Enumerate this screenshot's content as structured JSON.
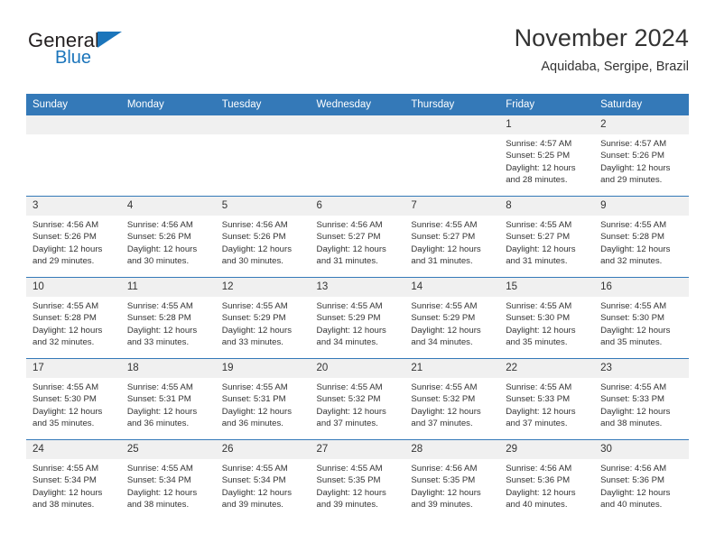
{
  "brand": {
    "name_part1": "General",
    "name_part2": "Blue",
    "accent_color": "#1b75bb"
  },
  "header": {
    "title": "November 2024",
    "location": "Aquidaba, Sergipe, Brazil"
  },
  "calendar": {
    "header_color": "#3479b8",
    "daynum_band_color": "#f0f0f0",
    "weekday_headers": [
      "Sunday",
      "Monday",
      "Tuesday",
      "Wednesday",
      "Thursday",
      "Friday",
      "Saturday"
    ],
    "weeks": [
      [
        {
          "day": "",
          "sunrise": "",
          "sunset": "",
          "daylight": "",
          "empty": true
        },
        {
          "day": "",
          "sunrise": "",
          "sunset": "",
          "daylight": "",
          "empty": true
        },
        {
          "day": "",
          "sunrise": "",
          "sunset": "",
          "daylight": "",
          "empty": true
        },
        {
          "day": "",
          "sunrise": "",
          "sunset": "",
          "daylight": "",
          "empty": true
        },
        {
          "day": "",
          "sunrise": "",
          "sunset": "",
          "daylight": "",
          "empty": true
        },
        {
          "day": "1",
          "sunrise": "Sunrise: 4:57 AM",
          "sunset": "Sunset: 5:25 PM",
          "daylight": "Daylight: 12 hours and 28 minutes."
        },
        {
          "day": "2",
          "sunrise": "Sunrise: 4:57 AM",
          "sunset": "Sunset: 5:26 PM",
          "daylight": "Daylight: 12 hours and 29 minutes."
        }
      ],
      [
        {
          "day": "3",
          "sunrise": "Sunrise: 4:56 AM",
          "sunset": "Sunset: 5:26 PM",
          "daylight": "Daylight: 12 hours and 29 minutes."
        },
        {
          "day": "4",
          "sunrise": "Sunrise: 4:56 AM",
          "sunset": "Sunset: 5:26 PM",
          "daylight": "Daylight: 12 hours and 30 minutes."
        },
        {
          "day": "5",
          "sunrise": "Sunrise: 4:56 AM",
          "sunset": "Sunset: 5:26 PM",
          "daylight": "Daylight: 12 hours and 30 minutes."
        },
        {
          "day": "6",
          "sunrise": "Sunrise: 4:56 AM",
          "sunset": "Sunset: 5:27 PM",
          "daylight": "Daylight: 12 hours and 31 minutes."
        },
        {
          "day": "7",
          "sunrise": "Sunrise: 4:55 AM",
          "sunset": "Sunset: 5:27 PM",
          "daylight": "Daylight: 12 hours and 31 minutes."
        },
        {
          "day": "8",
          "sunrise": "Sunrise: 4:55 AM",
          "sunset": "Sunset: 5:27 PM",
          "daylight": "Daylight: 12 hours and 31 minutes."
        },
        {
          "day": "9",
          "sunrise": "Sunrise: 4:55 AM",
          "sunset": "Sunset: 5:28 PM",
          "daylight": "Daylight: 12 hours and 32 minutes."
        }
      ],
      [
        {
          "day": "10",
          "sunrise": "Sunrise: 4:55 AM",
          "sunset": "Sunset: 5:28 PM",
          "daylight": "Daylight: 12 hours and 32 minutes."
        },
        {
          "day": "11",
          "sunrise": "Sunrise: 4:55 AM",
          "sunset": "Sunset: 5:28 PM",
          "daylight": "Daylight: 12 hours and 33 minutes."
        },
        {
          "day": "12",
          "sunrise": "Sunrise: 4:55 AM",
          "sunset": "Sunset: 5:29 PM",
          "daylight": "Daylight: 12 hours and 33 minutes."
        },
        {
          "day": "13",
          "sunrise": "Sunrise: 4:55 AM",
          "sunset": "Sunset: 5:29 PM",
          "daylight": "Daylight: 12 hours and 34 minutes."
        },
        {
          "day": "14",
          "sunrise": "Sunrise: 4:55 AM",
          "sunset": "Sunset: 5:29 PM",
          "daylight": "Daylight: 12 hours and 34 minutes."
        },
        {
          "day": "15",
          "sunrise": "Sunrise: 4:55 AM",
          "sunset": "Sunset: 5:30 PM",
          "daylight": "Daylight: 12 hours and 35 minutes."
        },
        {
          "day": "16",
          "sunrise": "Sunrise: 4:55 AM",
          "sunset": "Sunset: 5:30 PM",
          "daylight": "Daylight: 12 hours and 35 minutes."
        }
      ],
      [
        {
          "day": "17",
          "sunrise": "Sunrise: 4:55 AM",
          "sunset": "Sunset: 5:30 PM",
          "daylight": "Daylight: 12 hours and 35 minutes."
        },
        {
          "day": "18",
          "sunrise": "Sunrise: 4:55 AM",
          "sunset": "Sunset: 5:31 PM",
          "daylight": "Daylight: 12 hours and 36 minutes."
        },
        {
          "day": "19",
          "sunrise": "Sunrise: 4:55 AM",
          "sunset": "Sunset: 5:31 PM",
          "daylight": "Daylight: 12 hours and 36 minutes."
        },
        {
          "day": "20",
          "sunrise": "Sunrise: 4:55 AM",
          "sunset": "Sunset: 5:32 PM",
          "daylight": "Daylight: 12 hours and 37 minutes."
        },
        {
          "day": "21",
          "sunrise": "Sunrise: 4:55 AM",
          "sunset": "Sunset: 5:32 PM",
          "daylight": "Daylight: 12 hours and 37 minutes."
        },
        {
          "day": "22",
          "sunrise": "Sunrise: 4:55 AM",
          "sunset": "Sunset: 5:33 PM",
          "daylight": "Daylight: 12 hours and 37 minutes."
        },
        {
          "day": "23",
          "sunrise": "Sunrise: 4:55 AM",
          "sunset": "Sunset: 5:33 PM",
          "daylight": "Daylight: 12 hours and 38 minutes."
        }
      ],
      [
        {
          "day": "24",
          "sunrise": "Sunrise: 4:55 AM",
          "sunset": "Sunset: 5:34 PM",
          "daylight": "Daylight: 12 hours and 38 minutes."
        },
        {
          "day": "25",
          "sunrise": "Sunrise: 4:55 AM",
          "sunset": "Sunset: 5:34 PM",
          "daylight": "Daylight: 12 hours and 38 minutes."
        },
        {
          "day": "26",
          "sunrise": "Sunrise: 4:55 AM",
          "sunset": "Sunset: 5:34 PM",
          "daylight": "Daylight: 12 hours and 39 minutes."
        },
        {
          "day": "27",
          "sunrise": "Sunrise: 4:55 AM",
          "sunset": "Sunset: 5:35 PM",
          "daylight": "Daylight: 12 hours and 39 minutes."
        },
        {
          "day": "28",
          "sunrise": "Sunrise: 4:56 AM",
          "sunset": "Sunset: 5:35 PM",
          "daylight": "Daylight: 12 hours and 39 minutes."
        },
        {
          "day": "29",
          "sunrise": "Sunrise: 4:56 AM",
          "sunset": "Sunset: 5:36 PM",
          "daylight": "Daylight: 12 hours and 40 minutes."
        },
        {
          "day": "30",
          "sunrise": "Sunrise: 4:56 AM",
          "sunset": "Sunset: 5:36 PM",
          "daylight": "Daylight: 12 hours and 40 minutes."
        }
      ]
    ]
  }
}
